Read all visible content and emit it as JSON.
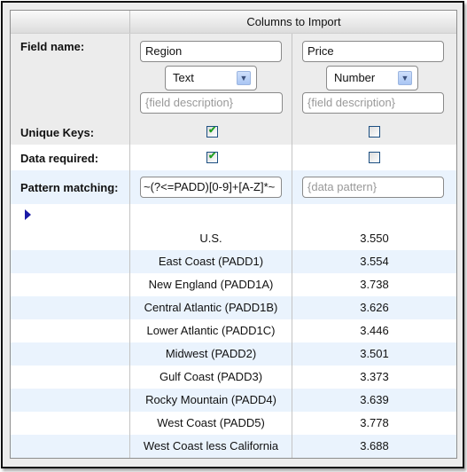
{
  "header": {
    "title": "Columns to Import"
  },
  "labels": {
    "field_name": "Field name:",
    "unique_keys": "Unique Keys:",
    "data_required": "Data required:",
    "pattern_matching": "Pattern matching:"
  },
  "columns": [
    {
      "field_name": "Region",
      "type": "Text",
      "description_placeholder": "{field description}",
      "unique_key": true,
      "data_required": true,
      "pattern": "~(?<=PADD)[0-9]+[A-Z]*~",
      "pattern_placeholder": "{data pattern}"
    },
    {
      "field_name": "Price",
      "type": "Number",
      "description_placeholder": "{field description}",
      "unique_key": false,
      "data_required": false,
      "pattern": "",
      "pattern_placeholder": "{data pattern}"
    }
  ],
  "icons": {
    "row_marker": "play-triangle-icon",
    "dropdown": "chevron-down-icon",
    "check": "checkmark-icon"
  },
  "colors": {
    "accent_triangle": "#1a1aa6",
    "check": "#22a022",
    "alt_row": "#eaf3fd"
  },
  "rows": [
    {
      "region": "U.S.",
      "price": "3.550"
    },
    {
      "region": "East Coast (PADD1)",
      "price": "3.554"
    },
    {
      "region": "New England (PADD1A)",
      "price": "3.738"
    },
    {
      "region": "Central Atlantic (PADD1B)",
      "price": "3.626"
    },
    {
      "region": "Lower Atlantic (PADD1C)",
      "price": "3.446"
    },
    {
      "region": "Midwest (PADD2)",
      "price": "3.501"
    },
    {
      "region": "Gulf Coast (PADD3)",
      "price": "3.373"
    },
    {
      "region": "Rocky Mountain (PADD4)",
      "price": "3.639"
    },
    {
      "region": "West Coast (PADD5)",
      "price": "3.778"
    },
    {
      "region": "West Coast less California",
      "price": "3.688"
    }
  ]
}
